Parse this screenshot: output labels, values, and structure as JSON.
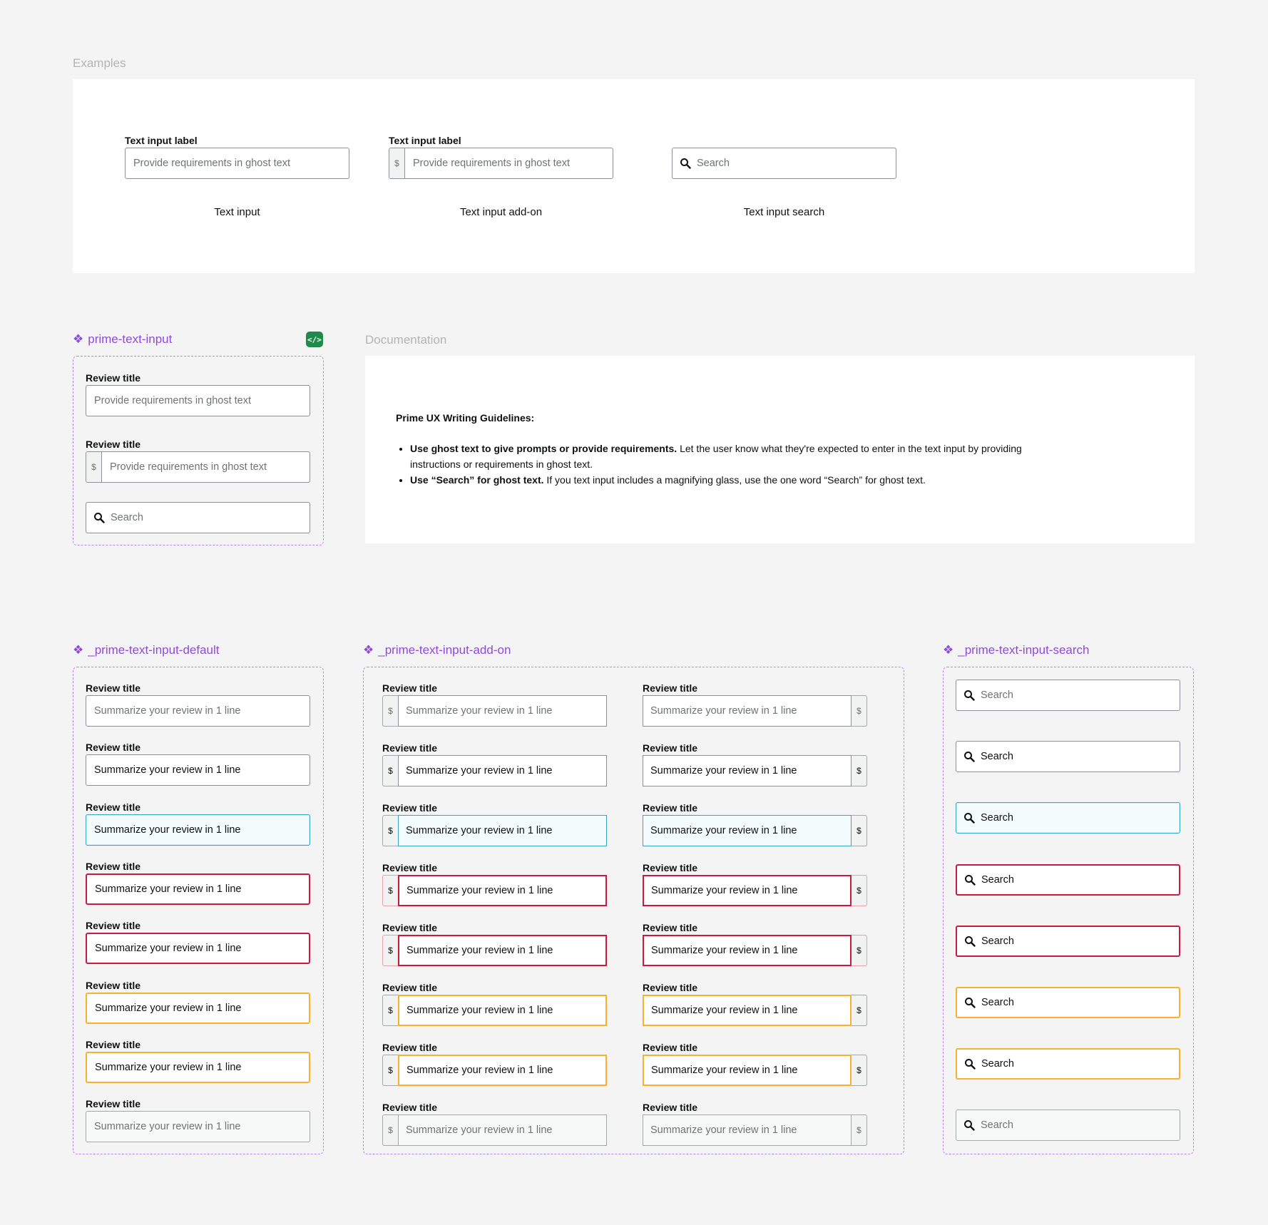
{
  "examples": {
    "section_title": "Examples",
    "input_label": "Text input label",
    "ghost_text": "Provide requirements in ghost text",
    "addon_symbol": "$",
    "search_placeholder": "Search",
    "captions": [
      "Text input",
      "Text input add-on",
      "Text input search"
    ]
  },
  "prime_text_input": {
    "title": "prime-text-input",
    "code_badge": "</>",
    "label": "Review title",
    "ghost_text": "Provide requirements in ghost text",
    "addon_symbol": "$",
    "search_placeholder": "Search"
  },
  "documentation": {
    "section_title": "Documentation",
    "heading": "Prime UX Writing Guidelines:",
    "bullets": [
      {
        "bold": "Use ghost text to give prompts or provide requirements.",
        "text": " Let the user know what they're expected to enter in the text input by providing instructions or requirements in ghost text."
      },
      {
        "bold": "Use “Search” for ghost text.",
        "text": " If you text input includes a magnifying glass, use the one word “Search” for ghost text."
      }
    ]
  },
  "default_component": {
    "title": "_prime-text-input-default",
    "label": "Review title",
    "value": "Summarize your review in 1 line",
    "states": [
      "ghost",
      "filled",
      "focus",
      "error",
      "error",
      "warn",
      "warn",
      "disabled"
    ]
  },
  "addon_component": {
    "title": "_prime-text-input-add-on",
    "label": "Review title",
    "value": "Summarize your review in 1 line",
    "addon_symbol": "$",
    "states": [
      "ghost",
      "filled",
      "focus",
      "error",
      "error",
      "warn",
      "warn",
      "disabled"
    ]
  },
  "search_component": {
    "title": "_prime-text-input-search",
    "placeholder": "Search",
    "states": [
      "ghost",
      "filled",
      "focus",
      "error",
      "error",
      "warn",
      "warn",
      "disabled"
    ]
  },
  "colors": {
    "purple": "#8f4bd8",
    "focus": "#38a4c8",
    "error": "#d0173d",
    "warning": "#f7b12b",
    "badge": "#1e8a4c"
  }
}
